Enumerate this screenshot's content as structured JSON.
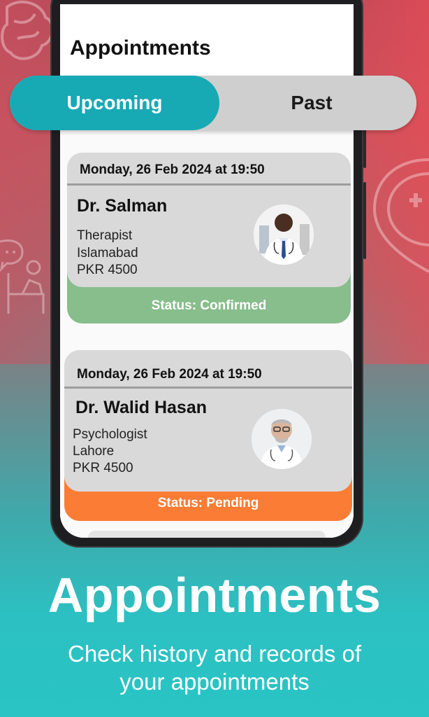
{
  "screen": {
    "title": "Appointments"
  },
  "tabs": {
    "upcoming": "Upcoming",
    "past": "Past"
  },
  "appointments": [
    {
      "datetime": "Monday, 26 Feb 2024 at 19:50",
      "doctor": "Dr. Salman",
      "specialty": "Therapist",
      "city": "Islamabad",
      "fee": "PKR 4500",
      "status": "Status: Confirmed",
      "status_color": "#88bd8c"
    },
    {
      "datetime": "Monday, 26 Feb 2024 at 19:50",
      "doctor": "Dr. Walid Hasan",
      "specialty": "Psychologist",
      "city": "Lahore",
      "fee": "PKR 4500",
      "status": "Status: Pending",
      "status_color": "#fb7c35"
    }
  ],
  "promo": {
    "title": "Appointments",
    "subtitle_line1": "Check history and records of",
    "subtitle_line2": "your appointments"
  },
  "colors": {
    "accent": "#17a9b4",
    "tab_inactive": "#cfcfcf"
  }
}
